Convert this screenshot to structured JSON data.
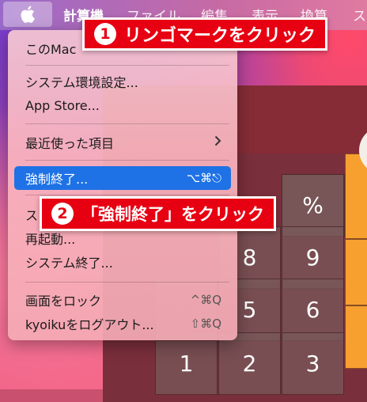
{
  "menubar": {
    "apple_icon": "apple-logo-icon",
    "items": [
      "計算機",
      "ファイル",
      "編集",
      "表示",
      "換算",
      "ス"
    ]
  },
  "apple_menu": {
    "items": [
      {
        "label": "このMac"
      },
      {
        "label": "システム環境設定..."
      },
      {
        "label": "App Store..."
      },
      {
        "label": "最近使った項目",
        "submenu_icon": "chevron-right-icon"
      },
      {
        "label": "強制終了...",
        "shortcut": "⌥⌘⎋",
        "selected": true
      },
      {
        "label": "ス"
      },
      {
        "label": "再起動..."
      },
      {
        "label": "システム終了..."
      },
      {
        "label": "画面をロック",
        "shortcut": "^⌘Q"
      },
      {
        "label": "kyoikuをログアウト...",
        "shortcut": "⇧⌘Q"
      }
    ]
  },
  "calculator": {
    "keys": [
      "%",
      "8",
      "9",
      "5",
      "6",
      "2",
      "3",
      "1"
    ]
  },
  "callouts": [
    {
      "number": "1",
      "text": "リンゴマークをクリック"
    },
    {
      "number": "2",
      "text": "「強制終了」をクリック"
    }
  ],
  "colors": {
    "callout_red": "#e60012",
    "selection_blue": "#1e72e6",
    "operator_orange": "#f7a030"
  }
}
